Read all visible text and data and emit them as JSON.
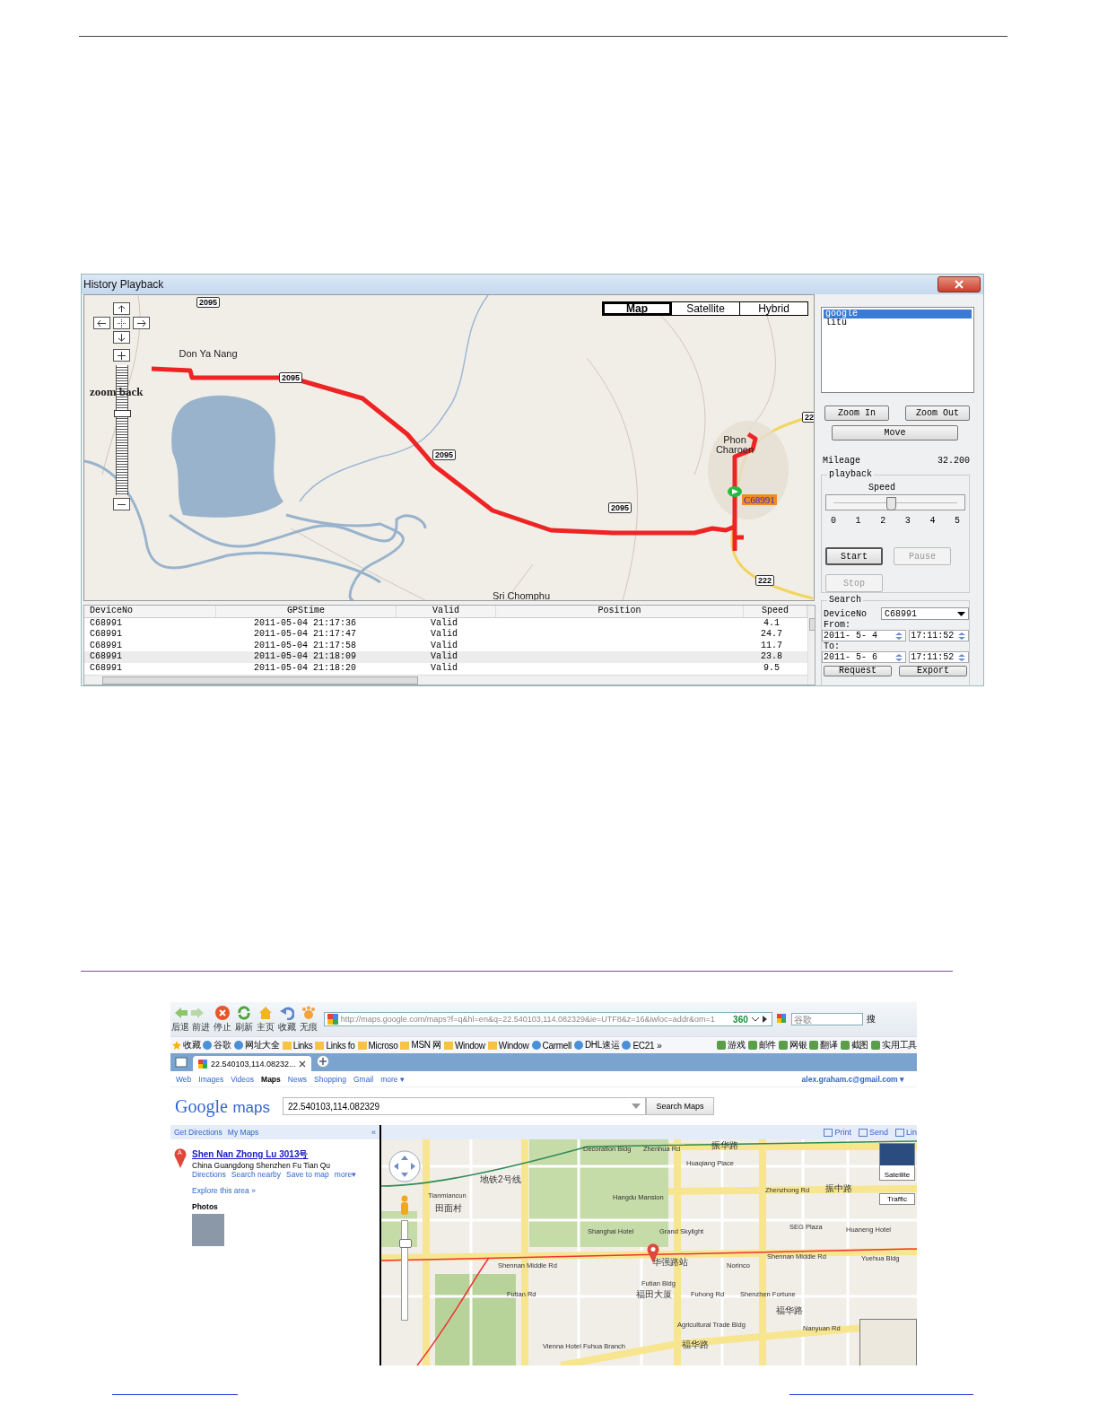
{
  "playback_window": {
    "title": "History Playback",
    "map": {
      "type_buttons": [
        {
          "label": "Map",
          "selected": true
        },
        {
          "label": "Satellite",
          "selected": false
        },
        {
          "label": "Hybrid",
          "selected": false
        }
      ],
      "zoom_slider": {
        "level": 0.65
      },
      "zoom_back": "zoom back",
      "labels": [
        {
          "kind": "shield",
          "text": "2095"
        },
        {
          "kind": "place",
          "text": "Don Ya Nang"
        },
        {
          "kind": "shield",
          "text": "2095"
        },
        {
          "kind": "shield",
          "text": "2095"
        },
        {
          "kind": "shield",
          "text": "2095"
        },
        {
          "kind": "shield",
          "text": "22"
        },
        {
          "kind": "place",
          "text": "Phon Charoen"
        },
        {
          "kind": "shield",
          "text": "222"
        },
        {
          "kind": "place",
          "text": "Sri Chomphu"
        }
      ],
      "vehicle": {
        "label": "C68991"
      }
    },
    "table": {
      "columns": [
        "DeviceNo",
        "GPStime",
        "Valid",
        "Position",
        "Speed"
      ],
      "rows": [
        {
          "device_no": "C68991",
          "gps_time": "2011-05-04 21:17:36",
          "valid": "Valid",
          "speed": "4.1",
          "selected": false
        },
        {
          "device_no": "C68991",
          "gps_time": "2011-05-04 21:17:47",
          "valid": "Valid",
          "speed": "24.7",
          "selected": false
        },
        {
          "device_no": "C68991",
          "gps_time": "2011-05-04 21:17:58",
          "valid": "Valid",
          "speed": "11.7",
          "selected": false
        },
        {
          "device_no": "C68991",
          "gps_time": "2011-05-04 21:18:09",
          "valid": "Valid",
          "speed": "23.8",
          "selected": true
        },
        {
          "device_no": "C68991",
          "gps_time": "2011-05-04 21:18:20",
          "valid": "Valid",
          "speed": "9.5",
          "selected": false
        }
      ]
    },
    "side": {
      "map_sources": [
        {
          "label": "google",
          "selected": true
        },
        {
          "label": "litu",
          "selected": false
        }
      ],
      "zoom_in": "Zoom In",
      "zoom_out": "Zoom Out",
      "move": "Move",
      "mileage_label": "Mileage",
      "mileage_value": "32.200",
      "playback": {
        "legend": "playback",
        "speed_label": "Speed",
        "level": 0.47,
        "ticks": [
          "0",
          "1",
          "2",
          "3",
          "4",
          "5"
        ]
      },
      "controls": [
        {
          "label": "Start",
          "disabled": false
        },
        {
          "label": "Pause",
          "disabled": true
        },
        {
          "label": "Stop",
          "disabled": true
        }
      ],
      "search": {
        "legend": "Search",
        "device_label": "DeviceNo",
        "device_value": "C68991",
        "from_label": "From:",
        "from_date": "2011- 5- 4",
        "from_time": "17:11:52",
        "to_label": "To:",
        "to_date": "2011- 5- 6",
        "to_time": "17:11:52",
        "buttons": [
          "Request",
          "Export"
        ]
      }
    }
  },
  "browser": {
    "nav_buttons": [
      {
        "kind": "back_forward",
        "label": "后退 前进"
      },
      {
        "kind": "stop",
        "label": "停止"
      },
      {
        "kind": "refresh",
        "label": "刷新"
      },
      {
        "kind": "home",
        "label": "主页"
      },
      {
        "kind": "undo",
        "label": "收藏"
      },
      {
        "kind": "incognito",
        "label": "无痕"
      }
    ],
    "address": "http://maps.google.com/maps?f=q&hl=en&q=22.540103,114.082329&ie=UTF8&z=16&iwloc=addr&om=1",
    "address_badge": "360",
    "search_placeholder": "谷歌",
    "search_button": "搜",
    "favorites": [
      {
        "kind": "star",
        "label": "收藏"
      },
      {
        "kind": "site",
        "label": "谷歌"
      },
      {
        "kind": "site",
        "label": "网址大全"
      },
      {
        "kind": "folder",
        "label": "Links"
      },
      {
        "kind": "folder",
        "label": "Links fo"
      },
      {
        "kind": "folder",
        "label": "Microso"
      },
      {
        "kind": "folder",
        "label": "MSN 网"
      },
      {
        "kind": "folder",
        "label": "Window"
      },
      {
        "kind": "folder",
        "label": "Window"
      },
      {
        "kind": "site",
        "label": "Carmell"
      },
      {
        "kind": "site",
        "label": "DHL速运"
      },
      {
        "kind": "site",
        "label": "EC21"
      },
      {
        "kind": "more",
        "label": "»"
      }
    ],
    "tools": [
      "游戏",
      "邮件",
      "网银",
      "翻译",
      "截图",
      "实用工具"
    ],
    "tabs": [
      {
        "label": "22.540103,114.08232...",
        "selected": true
      }
    ],
    "google": {
      "links": [
        {
          "label": "Web",
          "selected": false
        },
        {
          "label": "Images",
          "selected": false
        },
        {
          "label": "Videos",
          "selected": false
        },
        {
          "label": "Maps",
          "selected": true
        },
        {
          "label": "News",
          "selected": false
        },
        {
          "label": "Shopping",
          "selected": false
        },
        {
          "label": "Gmail",
          "selected": false
        },
        {
          "label": "more ▾",
          "selected": false
        }
      ],
      "account": "alex.graham.c@gmail.com ▾",
      "logo_word": "Google",
      "logo_product": "maps",
      "query": "22.540103,114.082329",
      "search_button": "Search Maps",
      "left_tabs": [
        "Get Directions",
        "My Maps"
      ],
      "collapse": "«",
      "map_actions": [
        "Print",
        "Send",
        "Lin"
      ],
      "result": {
        "marker": "A",
        "title": "Shen Nan Zhong Lu 3013号",
        "address": "China Guangdong Shenzhen Fu Tian Qu",
        "links": [
          "Directions",
          "Search nearby",
          "Save to map",
          "more▾"
        ],
        "explore": "Explore this area »",
        "photos": "Photos"
      },
      "map_buttons": [
        "Satellite",
        "Traffic"
      ],
      "map_zoom": {
        "level": 0.8
      },
      "map_labels": [
        {
          "kind": "latin",
          "text": "Decoration Bldg"
        },
        {
          "kind": "latin",
          "text": "Zhenhua Rd"
        },
        {
          "kind": "cjk",
          "text": "振华路"
        },
        {
          "kind": "latin",
          "text": "Huaqiang Place"
        },
        {
          "kind": "cjk",
          "text": "地铁2号线"
        },
        {
          "kind": "latin",
          "text": "Tianmiancun"
        },
        {
          "kind": "latin",
          "text": "Hangdu Mansion"
        },
        {
          "kind": "latin",
          "text": "Zhenzhong Rd"
        },
        {
          "kind": "cjk",
          "text": "振中路"
        },
        {
          "kind": "cjk",
          "text": "田面村"
        },
        {
          "kind": "latin",
          "text": "Shanghai Hotel"
        },
        {
          "kind": "latin",
          "text": "Grand Skylight"
        },
        {
          "kind": "latin",
          "text": "SEG Plaza"
        },
        {
          "kind": "latin",
          "text": "Huaneng Hotel"
        },
        {
          "kind": "latin",
          "text": "Shennan Middle Rd"
        },
        {
          "kind": "cjk",
          "text": "华强路站"
        },
        {
          "kind": "latin",
          "text": "Norinco"
        },
        {
          "kind": "latin",
          "text": "Shennan Middle Rd"
        },
        {
          "kind": "latin",
          "text": "Yuehua Bldg"
        },
        {
          "kind": "latin",
          "text": "Futian Bldg"
        },
        {
          "kind": "latin",
          "text": "Futian Rd"
        },
        {
          "kind": "cjk",
          "text": "福田大厦"
        },
        {
          "kind": "latin",
          "text": "Fuhong Rd"
        },
        {
          "kind": "latin",
          "text": "Shenzhen Fortune"
        },
        {
          "kind": "cjk",
          "text": "福华路"
        },
        {
          "kind": "latin",
          "text": "Agricultural Trade Bldg"
        },
        {
          "kind": "latin",
          "text": "Nanyuan Rd"
        },
        {
          "kind": "latin",
          "text": "Vienna Hotel Fuhua Branch"
        },
        {
          "kind": "cjk",
          "text": "福华路"
        }
      ]
    }
  }
}
